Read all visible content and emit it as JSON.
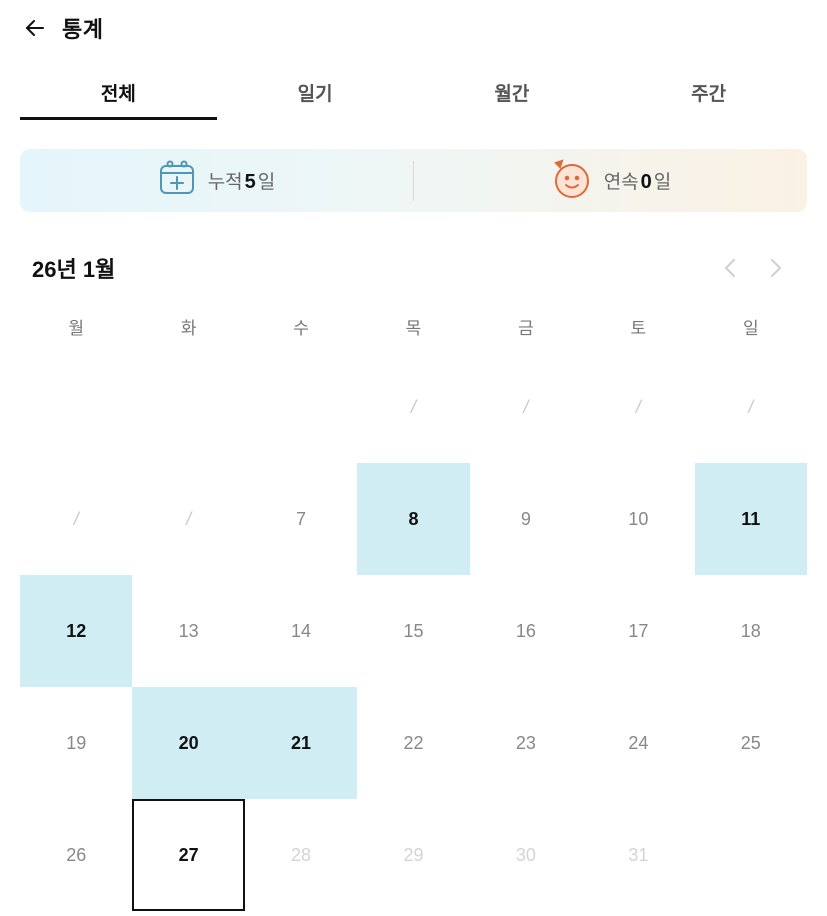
{
  "header": {
    "title": "통계",
    "back_icon": "arrow-left-icon"
  },
  "tabs": [
    {
      "label": "전체",
      "active": true
    },
    {
      "label": "일기",
      "active": false
    },
    {
      "label": "월간",
      "active": false
    },
    {
      "label": "주간",
      "active": false
    }
  ],
  "summary": {
    "total": {
      "icon": "calendar-plus-icon",
      "prefix": "누적",
      "value": "5",
      "suffix": "일"
    },
    "streak": {
      "icon": "smiley-face-icon",
      "prefix": "연속",
      "value": "0",
      "suffix": "일"
    }
  },
  "calendar": {
    "month_title": "26년 1월",
    "prev_icon": "chevron-left-icon",
    "next_icon": "chevron-right-icon",
    "weekdays": [
      "월",
      "화",
      "수",
      "목",
      "금",
      "토",
      "일"
    ],
    "cells": [
      {
        "text": "",
        "state": "empty"
      },
      {
        "text": "",
        "state": "empty"
      },
      {
        "text": "",
        "state": "empty"
      },
      {
        "text": "/",
        "state": "slash"
      },
      {
        "text": "/",
        "state": "slash"
      },
      {
        "text": "/",
        "state": "slash"
      },
      {
        "text": "/",
        "state": "slash"
      },
      {
        "text": "/",
        "state": "slash"
      },
      {
        "text": "/",
        "state": "slash"
      },
      {
        "text": "7",
        "state": "past"
      },
      {
        "text": "8",
        "state": "filled"
      },
      {
        "text": "9",
        "state": "past"
      },
      {
        "text": "10",
        "state": "past"
      },
      {
        "text": "11",
        "state": "filled"
      },
      {
        "text": "12",
        "state": "filled"
      },
      {
        "text": "13",
        "state": "past"
      },
      {
        "text": "14",
        "state": "past"
      },
      {
        "text": "15",
        "state": "past"
      },
      {
        "text": "16",
        "state": "past"
      },
      {
        "text": "17",
        "state": "past"
      },
      {
        "text": "18",
        "state": "past"
      },
      {
        "text": "19",
        "state": "past"
      },
      {
        "text": "20",
        "state": "filled"
      },
      {
        "text": "21",
        "state": "filled"
      },
      {
        "text": "22",
        "state": "past"
      },
      {
        "text": "23",
        "state": "past"
      },
      {
        "text": "24",
        "state": "past"
      },
      {
        "text": "25",
        "state": "past"
      },
      {
        "text": "26",
        "state": "past"
      },
      {
        "text": "27",
        "state": "today"
      },
      {
        "text": "28",
        "state": "future"
      },
      {
        "text": "29",
        "state": "future"
      },
      {
        "text": "30",
        "state": "future"
      },
      {
        "text": "31",
        "state": "future"
      },
      {
        "text": "",
        "state": "empty"
      }
    ]
  },
  "colors": {
    "filled": "#d0edf4",
    "calendar_icon": "#4f97b4",
    "face_icon": "#e0693a"
  }
}
